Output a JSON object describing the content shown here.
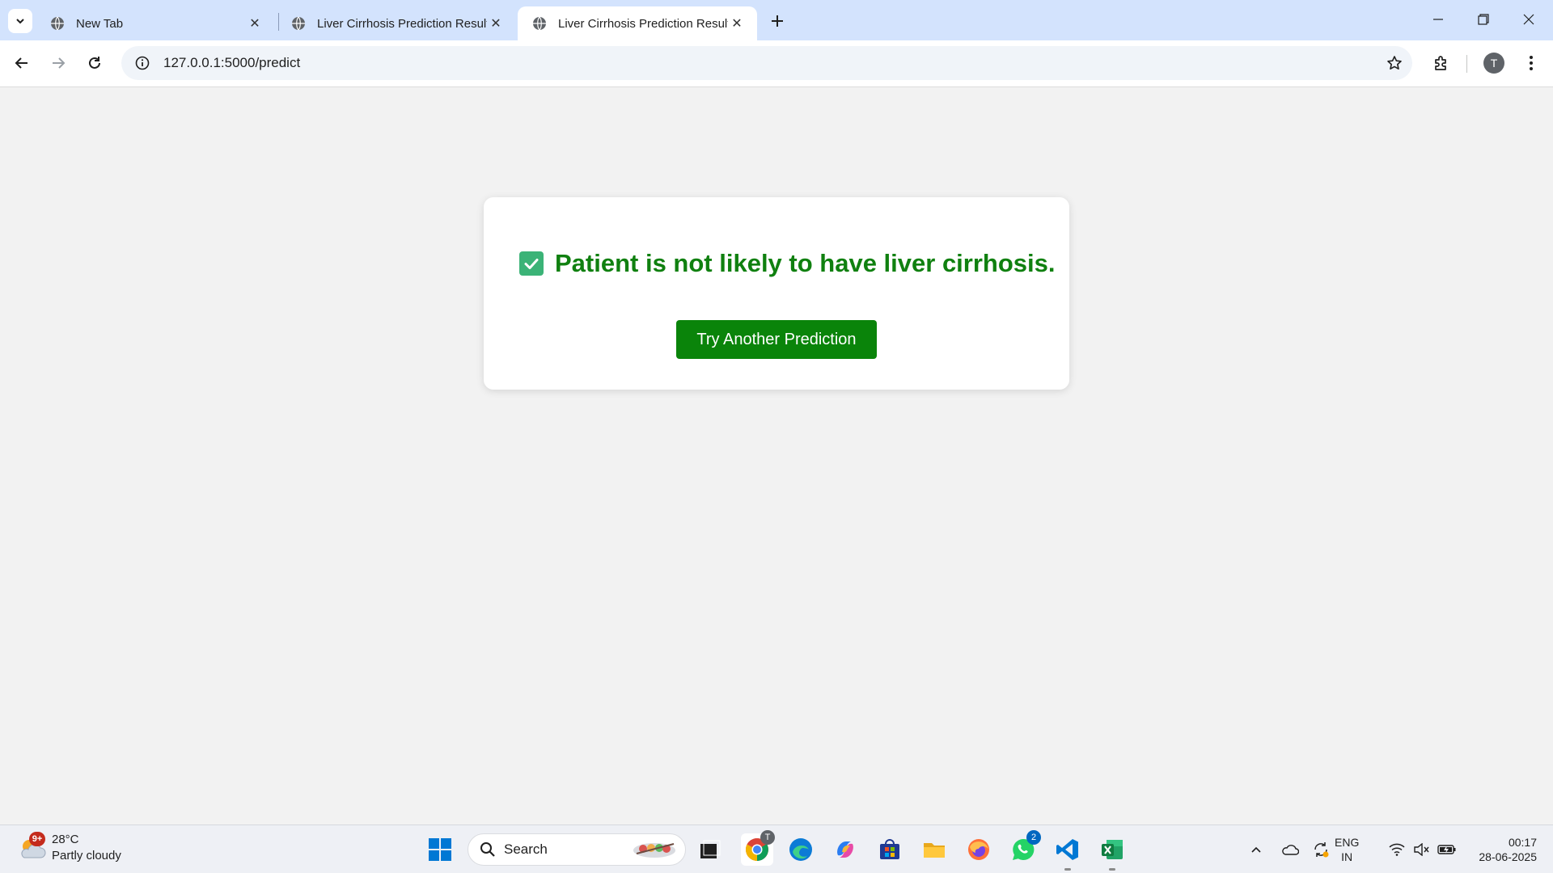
{
  "browser": {
    "tabs": [
      {
        "title": "New Tab",
        "active": false
      },
      {
        "title": "Liver Cirrhosis Prediction Result",
        "active": false
      },
      {
        "title": "Liver Cirrhosis Prediction Result",
        "active": true
      }
    ],
    "url": "127.0.0.1:5000/predict",
    "profile_initial": "T"
  },
  "page": {
    "result_icon": "check-mark-button-emoji",
    "result_text": "Patient is not likely to have liver cirrhosis.",
    "retry_label": "Try Another Prediction",
    "accent_color": "#108010",
    "button_color": "#0a840a"
  },
  "taskbar": {
    "weather": {
      "temperature": "28°C",
      "condition": "Partly cloudy",
      "badge": "9+"
    },
    "search_placeholder": "Search",
    "chrome_badge": "T",
    "whatsapp_badge": "2",
    "language": {
      "line1": "ENG",
      "line2": "IN"
    },
    "clock": {
      "time": "00:17",
      "date": "28-06-2025"
    }
  }
}
